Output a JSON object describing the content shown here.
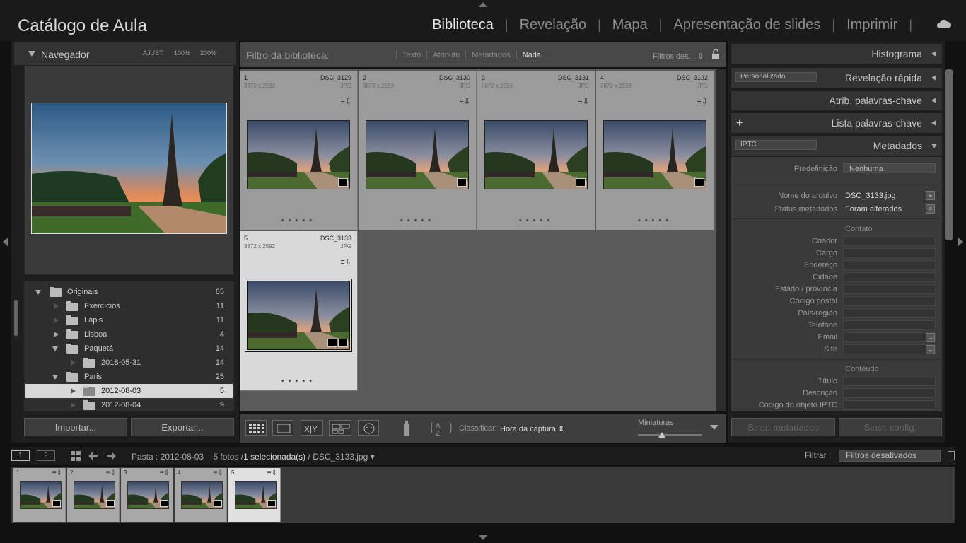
{
  "app": {
    "catalog_title": "Catálogo de Aula",
    "modules": [
      "Biblioteca",
      "Revelação",
      "Mapa",
      "Apresentação de slides",
      "Imprimir"
    ],
    "active_module": "Biblioteca"
  },
  "navigator": {
    "title": "Navegador",
    "opts": [
      "AJUST.",
      "100%",
      "200%"
    ]
  },
  "folders": [
    {
      "name": "Originais",
      "count": "65",
      "level": 0,
      "expand": "down"
    },
    {
      "name": "Exercícios",
      "count": "11",
      "level": 1,
      "expand": "none"
    },
    {
      "name": "Lápis",
      "count": "11",
      "level": 1,
      "expand": "none"
    },
    {
      "name": "Lisboa",
      "count": "4",
      "level": 1,
      "expand": "right"
    },
    {
      "name": "Paquetá",
      "count": "14",
      "level": 1,
      "expand": "down"
    },
    {
      "name": "2018-05-31",
      "count": "14",
      "level": 2,
      "expand": "none"
    },
    {
      "name": "Paris",
      "count": "25",
      "level": 1,
      "expand": "down"
    },
    {
      "name": "2012-08-03",
      "count": "5",
      "level": 2,
      "expand": "none",
      "selected": true
    },
    {
      "name": "2012-08-04",
      "count": "9",
      "level": 2,
      "expand": "none"
    }
  ],
  "left_buttons": {
    "import": "Importar...",
    "export": "Exportar..."
  },
  "filter": {
    "label": "Filtro da biblioteca:",
    "options": [
      "Texto",
      "Atributo",
      "Metadados",
      "Nada"
    ],
    "active": "Nada",
    "presets": "Filtros des..."
  },
  "photos": [
    {
      "idx": "1",
      "name": "DSC_3129",
      "dims": "3872 x 2592",
      "type": "JPG"
    },
    {
      "idx": "2",
      "name": "DSC_3130",
      "dims": "3872 x 2592",
      "type": "JPG"
    },
    {
      "idx": "3",
      "name": "DSC_3131",
      "dims": "3872 x 2592",
      "type": "JPG"
    },
    {
      "idx": "4",
      "name": "DSC_3132",
      "dims": "3872 x 2592",
      "type": "JPG"
    },
    {
      "idx": "5",
      "name": "DSC_3133",
      "dims": "3872 x 2592",
      "type": "JPG",
      "selected": true
    }
  ],
  "toolbar": {
    "sort_label": "Classificar:",
    "sort_value": "Hora da captura",
    "thumb_label": "Miniaturas"
  },
  "right": {
    "histogram": "Histograma",
    "quick_preset": "Personalizado",
    "quick_develop": "Revelação rápida",
    "keywording": "Atrib. palavras-chave",
    "keyword_list": "Lista palavras-chave",
    "meta_preset": "IPTC",
    "metadata": "Metadados",
    "predef_label": "Predefinição",
    "predef_value": "Nenhuma",
    "filename_label": "Nome do arquivo",
    "filename_value": "DSC_3133.jpg",
    "status_label": "Status metadados",
    "status_value": "Foram alterados",
    "contact_section": "Contato",
    "contact_fields": [
      "Criador",
      "Cargo",
      "Endereço",
      "Cidade",
      "Estado / província",
      "Código postal",
      "País/região",
      "Telefone",
      "Email",
      "Site"
    ],
    "content_section": "Conteúdo",
    "content_fields": [
      "Título",
      "Descrição",
      "Código do objeto IPTC"
    ],
    "sync_meta": "Sincr. metadados",
    "sync_config": "Sincr. config."
  },
  "filmstrip": {
    "screen1": "1",
    "screen2": "2",
    "folder_info": "Pasta : 2012-08-03",
    "count_info": "5 fotos /",
    "sel_info": "1 selecionada(s)",
    "file_info": "/ DSC_3133.jpg",
    "filter_label": "Filtrar :",
    "filter_value": "Filtros desativados"
  }
}
